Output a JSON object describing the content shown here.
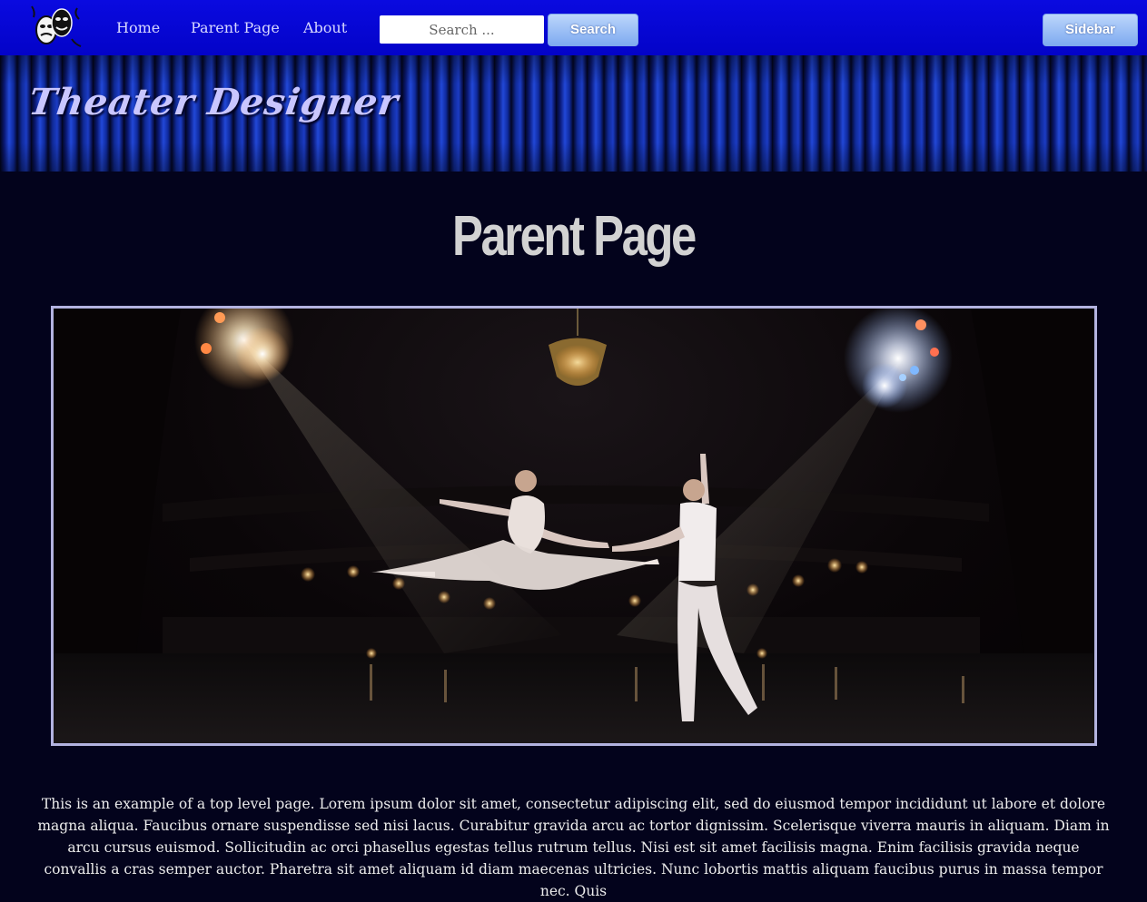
{
  "navbar": {
    "links": [
      "Home",
      "Parent Page",
      "About"
    ],
    "search_placeholder": "Search ...",
    "search_button": "Search",
    "sidebar_button": "Sidebar"
  },
  "banner": {
    "site_title": "Theater Designer"
  },
  "main": {
    "page_title": "Parent Page",
    "body_text": "This is an example of a top level page. Lorem ipsum dolor sit amet, consectetur adipiscing elit, sed do eiusmod tempor incididunt ut labore et dolore magna aliqua. Faucibus ornare suspendisse sed nisi lacus. Curabitur gravida arcu ac tortor dignissim. Scelerisque viverra mauris in aliquam. Diam in arcu cursus euismod. Sollicitudin ac orci phasellus egestas tellus rutrum tellus. Nisi est sit amet facilisis magna. Enim facilisis gravida neque convallis a cras semper auctor. Pharetra sit amet aliquam id diam maecenas ultricies. Nunc lobortis mattis aliquam faucibus purus in massa tempor nec. Quis"
  },
  "colors": {
    "navbar": "#0505d6",
    "page_background": "#03031c",
    "title_text": "#c9c6ff",
    "button": "#9cc0f5"
  }
}
